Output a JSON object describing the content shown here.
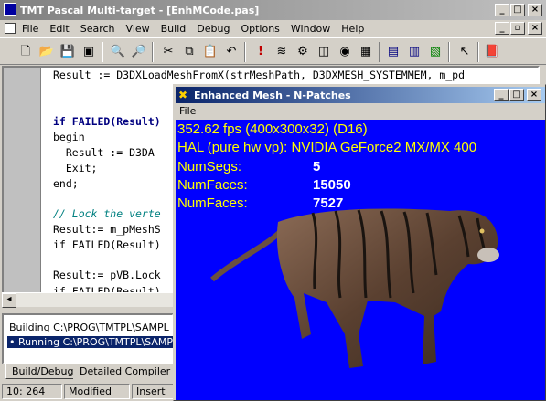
{
  "main_window": {
    "title": "TMT Pascal Multi-target - [EnhMCode.pas]",
    "menu": [
      "File",
      "Edit",
      "Search",
      "View",
      "Build",
      "Debug",
      "Options",
      "Window",
      "Help"
    ]
  },
  "editor": {
    "lines": [
      "Result := D3DXLoadMeshFromX(strMeshPath, D3DXMESH_SYSTEMMEM, m_pd",
      "",
      "",
      "if FAILED(Result)",
      "begin",
      "  Result := D3DA",
      "  Exit;",
      "end;",
      "",
      "// Lock the verte",
      "Result:= m_pMeshS",
      "if FAILED(Result)",
      "",
      "Result:= pVB.Lock",
      "if FAILED(Result)"
    ]
  },
  "output": {
    "lines": [
      "Building C:\\PROG\\TMTPL\\SAMPL",
      "Running C:\\PROG\\TMTPL\\SAMPL"
    ],
    "tabs": [
      "Build/Debug",
      "Detailed Compiler Rep"
    ]
  },
  "status": {
    "position": "10: 264",
    "modified": "Modified",
    "mode": "Insert"
  },
  "mesh_window": {
    "title": "Enhanced Mesh - N-Patches",
    "menu": "File",
    "fps": "352.62 fps (400x300x32) (D16)",
    "device": "HAL (pure hw vp): NVIDIA GeForce2 MX/MX 400",
    "stats": [
      {
        "label": "NumSegs:",
        "value": "5"
      },
      {
        "label": "NumFaces:",
        "value": "15050"
      },
      {
        "label": "NumFaces:",
        "value": "7527"
      }
    ]
  },
  "colors": {
    "viewport_bg": "#0000ff",
    "stat_text": "#ffff00",
    "active_title": "#0a246a"
  }
}
